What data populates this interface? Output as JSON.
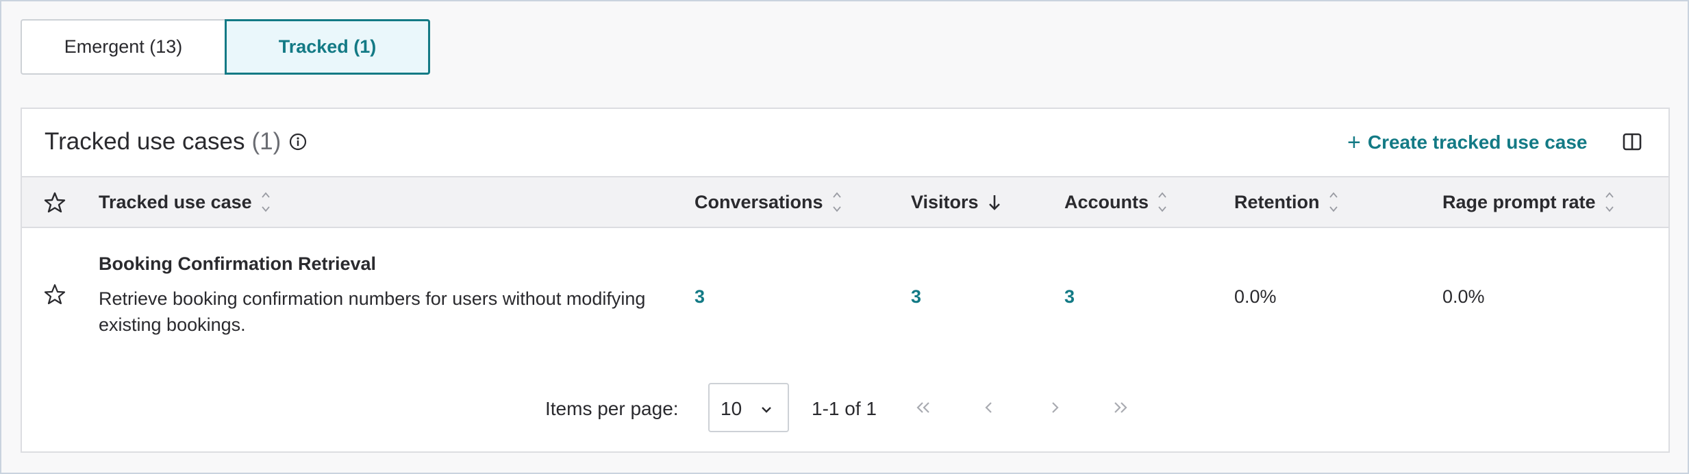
{
  "tabs": {
    "emergent_label": "Emergent (13)",
    "tracked_label": "Tracked (1)"
  },
  "card": {
    "title": "Tracked use cases",
    "count": "(1)",
    "create_label": "Create tracked use case",
    "create_symbol": "+"
  },
  "table": {
    "headers": {
      "use_case": "Tracked use case",
      "conversations": "Conversations",
      "visitors": "Visitors",
      "accounts": "Accounts",
      "retention": "Retention",
      "rage_prompt_rate": "Rage prompt rate"
    },
    "sorted_column": "visitors",
    "sort_direction": "descending",
    "rows": [
      {
        "name": "Booking Confirmation Retrieval",
        "description": "Retrieve booking confirmation numbers for users without modifying existing bookings.",
        "conversations": "3",
        "visitors": "3",
        "accounts": "3",
        "retention": "0.0%",
        "rage_prompt_rate": "0.0%"
      }
    ]
  },
  "pagination": {
    "items_per_page_label": "Items per page:",
    "items_per_page": "10",
    "range": "1-1 of 1"
  },
  "colors": {
    "accent": "#137a85",
    "active_tab_bg": "#eaf7fb",
    "header_bg": "#f2f2f4"
  },
  "icons": [
    "info-icon",
    "columns-icon",
    "star-icon",
    "sort-icon",
    "arrow-down-icon",
    "chevron-down-icon",
    "first-page-icon",
    "prev-page-icon",
    "next-page-icon",
    "last-page-icon"
  ]
}
